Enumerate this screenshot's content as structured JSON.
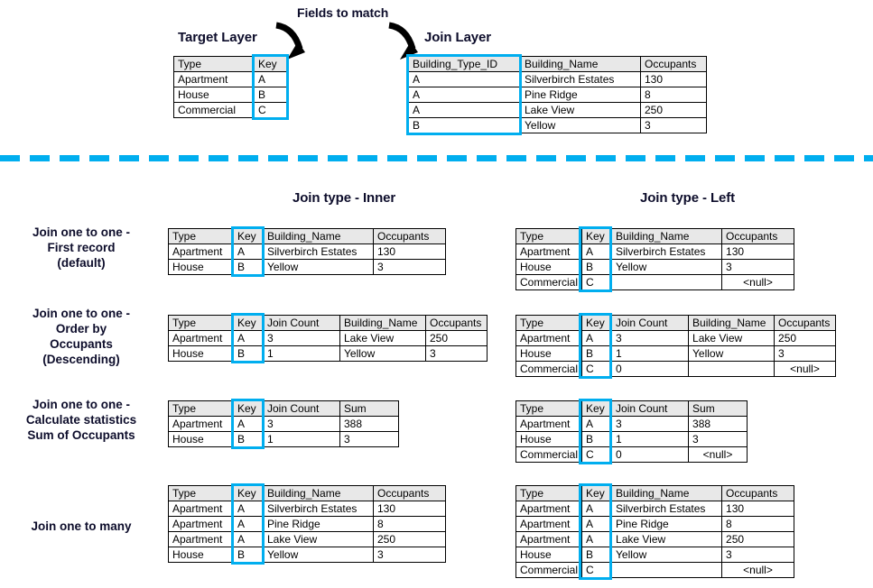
{
  "top": {
    "fields_to_match_label": "Fields to match",
    "target_layer_label": "Target Layer",
    "join_layer_label": "Join Layer",
    "target_table": {
      "headers": [
        "Type",
        "Key"
      ],
      "rows": [
        [
          "Apartment",
          "A"
        ],
        [
          "House",
          "B"
        ],
        [
          "Commercial",
          "C"
        ]
      ]
    },
    "join_table": {
      "headers": [
        "Building_Type_ID",
        "Building_Name",
        "Occupants"
      ],
      "rows": [
        [
          "A",
          "Silverbirch Estates",
          "130"
        ],
        [
          "A",
          "Pine Ridge",
          "8"
        ],
        [
          "A",
          "Lake View",
          "250"
        ],
        [
          "B",
          "Yellow",
          "3"
        ]
      ]
    }
  },
  "columns": {
    "inner_title": "Join type - Inner",
    "left_title": "Join type - Left"
  },
  "rows": [
    {
      "label": "Join one to one -\nFirst record\n(default)",
      "label_lines": [
        "Join one to one -",
        "First record",
        "(default)"
      ],
      "inner": {
        "headers": [
          "Type",
          "Key",
          "Building_Name",
          "Occupants"
        ],
        "rows": [
          [
            "Apartment",
            "A",
            "Silverbirch Estates",
            "130"
          ],
          [
            "House",
            "B",
            "Yellow",
            "3"
          ]
        ]
      },
      "left": {
        "headers": [
          "Type",
          "Key",
          "Building_Name",
          "Occupants"
        ],
        "rows": [
          [
            "Apartment",
            "A",
            "Silverbirch Estates",
            "130"
          ],
          [
            "House",
            "B",
            "Yellow",
            "3"
          ],
          [
            "Commercial",
            "C",
            "",
            "<null>"
          ]
        ]
      }
    },
    {
      "label_lines": [
        "Join one to one -",
        "Order by",
        "Occupants",
        "(Descending)"
      ],
      "inner": {
        "headers": [
          "Type",
          "Key",
          "Join Count",
          "Building_Name",
          "Occupants"
        ],
        "rows": [
          [
            "Apartment",
            "A",
            "3",
            "Lake View",
            "250"
          ],
          [
            "House",
            "B",
            "1",
            "Yellow",
            "3"
          ]
        ]
      },
      "left": {
        "headers": [
          "Type",
          "Key",
          "Join Count",
          "Building_Name",
          "Occupants"
        ],
        "rows": [
          [
            "Apartment",
            "A",
            "3",
            "Lake View",
            "250"
          ],
          [
            "House",
            "B",
            "1",
            "Yellow",
            "3"
          ],
          [
            "Commercial",
            "C",
            "0",
            "",
            "<null>"
          ]
        ]
      }
    },
    {
      "label_lines": [
        "Join one to one -",
        "Calculate statistics",
        "Sum of Occupants"
      ],
      "inner": {
        "headers": [
          "Type",
          "Key",
          "Join Count",
          "Sum"
        ],
        "rows": [
          [
            "Apartment",
            "A",
            "3",
            "388"
          ],
          [
            "House",
            "B",
            "1",
            "3"
          ]
        ]
      },
      "left": {
        "headers": [
          "Type",
          "Key",
          "Join Count",
          "Sum"
        ],
        "rows": [
          [
            "Apartment",
            "A",
            "3",
            "388"
          ],
          [
            "House",
            "B",
            "1",
            "3"
          ],
          [
            "Commercial",
            "C",
            "0",
            "<null>"
          ]
        ]
      }
    },
    {
      "label_lines": [
        "Join one to many"
      ],
      "inner": {
        "headers": [
          "Type",
          "Key",
          "Building_Name",
          "Occupants"
        ],
        "rows": [
          [
            "Apartment",
            "A",
            "Silverbirch Estates",
            "130"
          ],
          [
            "Apartment",
            "A",
            "Pine Ridge",
            "8"
          ],
          [
            "Apartment",
            "A",
            "Lake View",
            "250"
          ],
          [
            "House",
            "B",
            "Yellow",
            "3"
          ]
        ]
      },
      "left": {
        "headers": [
          "Type",
          "Key",
          "Building_Name",
          "Occupants"
        ],
        "rows": [
          [
            "Apartment",
            "A",
            "Silverbirch Estates",
            "130"
          ],
          [
            "Apartment",
            "A",
            "Pine Ridge",
            "8"
          ],
          [
            "Apartment",
            "A",
            "Lake View",
            "250"
          ],
          [
            "House",
            "B",
            "Yellow",
            "3"
          ],
          [
            "Commercial",
            "C",
            "",
            "<null>"
          ]
        ]
      }
    }
  ],
  "colors": {
    "highlight": "#00aeef",
    "divider": "#00aeef",
    "heading_text": "#0d0d2b",
    "header_fill": "#e8e8e8",
    "border": "#000000",
    "arrow": "#000000"
  },
  "icons": {
    "arrow_left": "curved-arrow-icon",
    "arrow_right": "curved-arrow-icon"
  }
}
